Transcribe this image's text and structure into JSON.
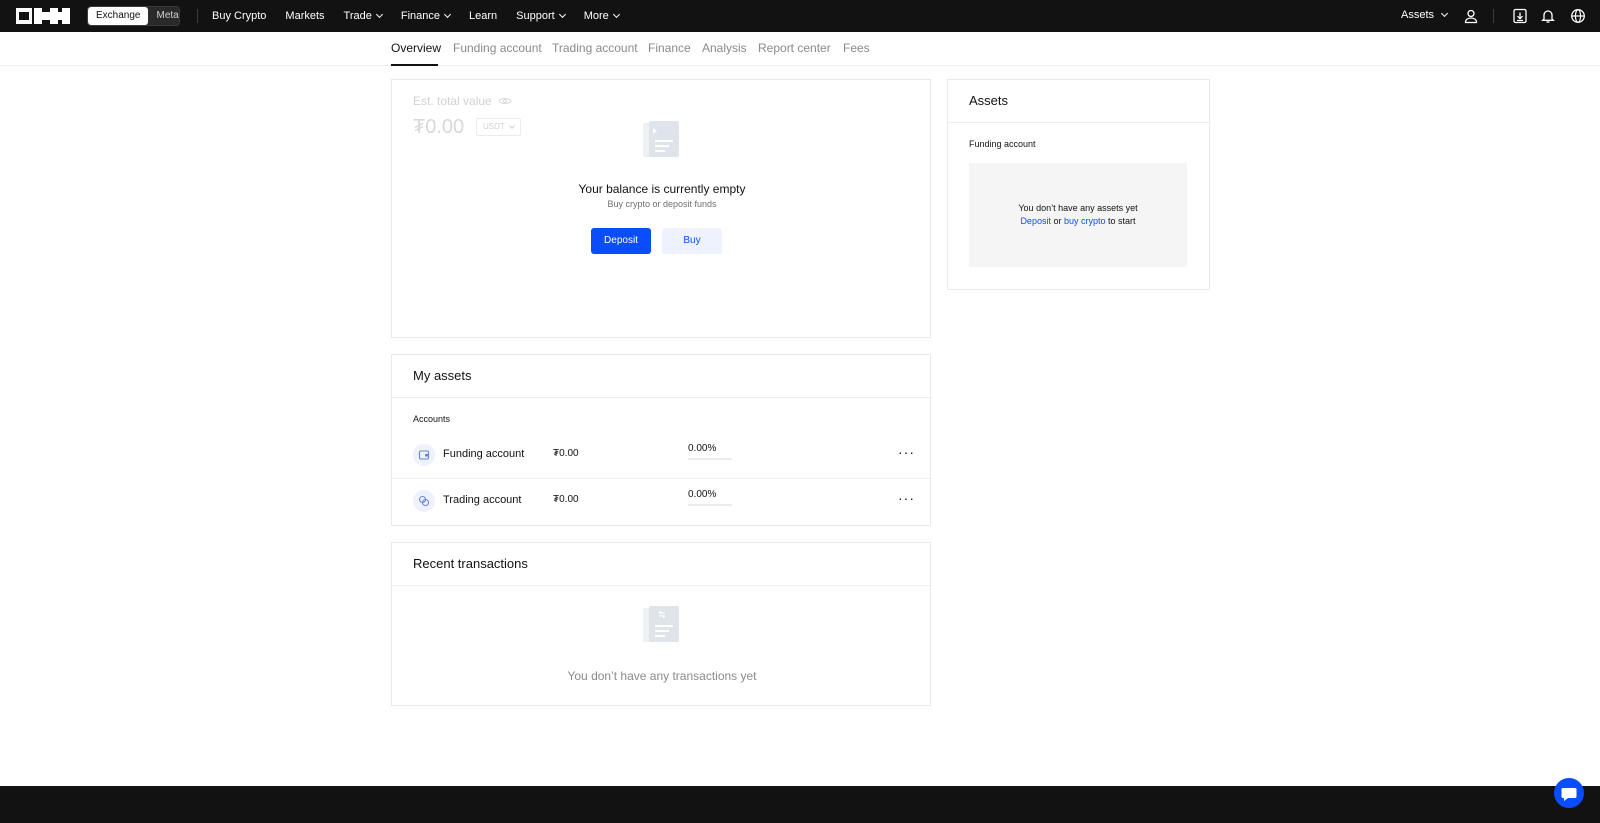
{
  "topbar": {
    "segments": [
      "Exchange",
      "MetaX"
    ],
    "nav": [
      {
        "label": "Buy Crypto",
        "dropdown": false
      },
      {
        "label": "Markets",
        "dropdown": false
      },
      {
        "label": "Trade",
        "dropdown": true
      },
      {
        "label": "Finance",
        "dropdown": true
      },
      {
        "label": "Learn",
        "dropdown": false
      },
      {
        "label": "Support",
        "dropdown": true
      },
      {
        "label": "More",
        "dropdown": true
      }
    ],
    "assets_label": "Assets",
    "icons": [
      "user-icon",
      "download-icon",
      "bell-icon",
      "globe-icon"
    ]
  },
  "subnav": {
    "tabs": [
      "Overview",
      "Funding account",
      "Trading account",
      "Finance",
      "Analysis",
      "Report center",
      "Fees"
    ],
    "active": "Overview"
  },
  "balance_card": {
    "label": "Est. total value",
    "value": "₮0.00",
    "currency": "USDT",
    "empty_title": "Your balance is currently empty",
    "empty_sub": "Buy crypto or deposit funds",
    "deposit_label": "Deposit",
    "buy_label": "Buy"
  },
  "assets_card": {
    "title": "Assets",
    "section": "Funding account",
    "empty_line1": "You don’t have any assets yet",
    "deposit_link": "Deposit",
    "or_text": "or",
    "buy_link": "buy crypto",
    "to_start": "to start"
  },
  "my_assets": {
    "title": "My assets",
    "accounts_label": "Accounts",
    "rows": [
      {
        "name": "Funding account",
        "value": "₮0.00",
        "percent": "0.00%",
        "share": 0
      },
      {
        "name": "Trading account",
        "value": "₮0.00",
        "percent": "0.00%",
        "share": 0
      }
    ]
  },
  "transactions": {
    "title": "Recent transactions",
    "empty": "You don’t have any transactions yet"
  },
  "colors": {
    "accent": "#0c4cff",
    "topbar": "#121212"
  }
}
